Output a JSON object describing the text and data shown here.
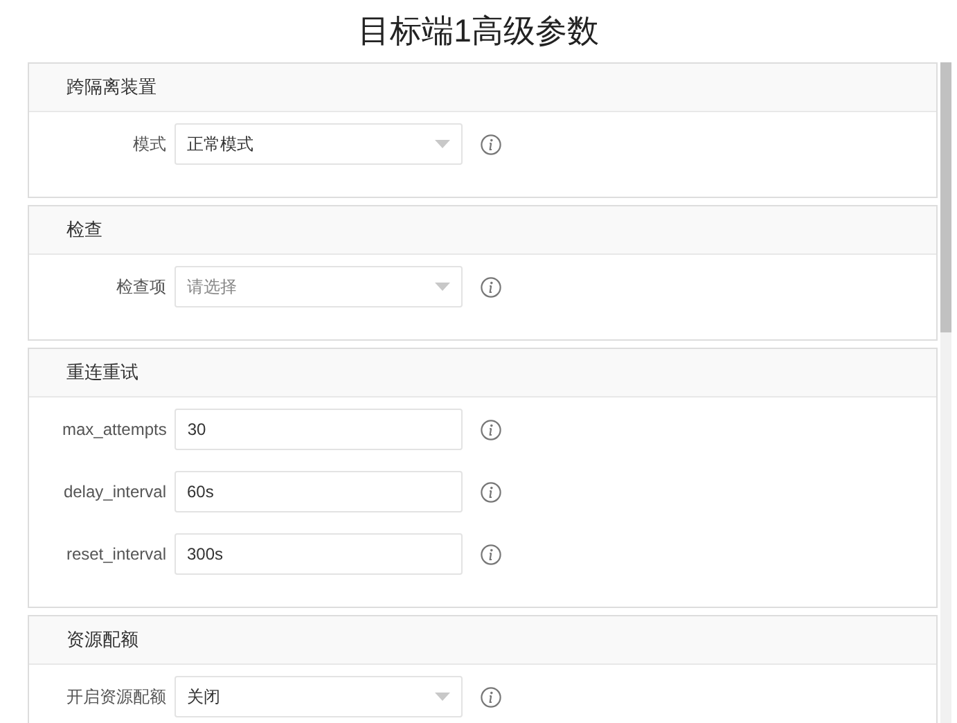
{
  "title": "目标端1高级参数",
  "sections": [
    {
      "title": "跨隔离装置",
      "fields": [
        {
          "label": "模式",
          "kind": "select",
          "value": "正常模式"
        }
      ]
    },
    {
      "title": "检查",
      "fields": [
        {
          "label": "检查项",
          "kind": "select",
          "placeholder": "请选择"
        }
      ]
    },
    {
      "title": "重连重试",
      "fields": [
        {
          "label": "max_attempts",
          "kind": "text",
          "value": "30"
        },
        {
          "label": "delay_interval",
          "kind": "text",
          "value": "60s"
        },
        {
          "label": "reset_interval",
          "kind": "text",
          "value": "300s"
        }
      ]
    },
    {
      "title": "资源配额",
      "fields": [
        {
          "label": "开启资源配额",
          "kind": "select",
          "value": "关闭"
        }
      ]
    }
  ]
}
